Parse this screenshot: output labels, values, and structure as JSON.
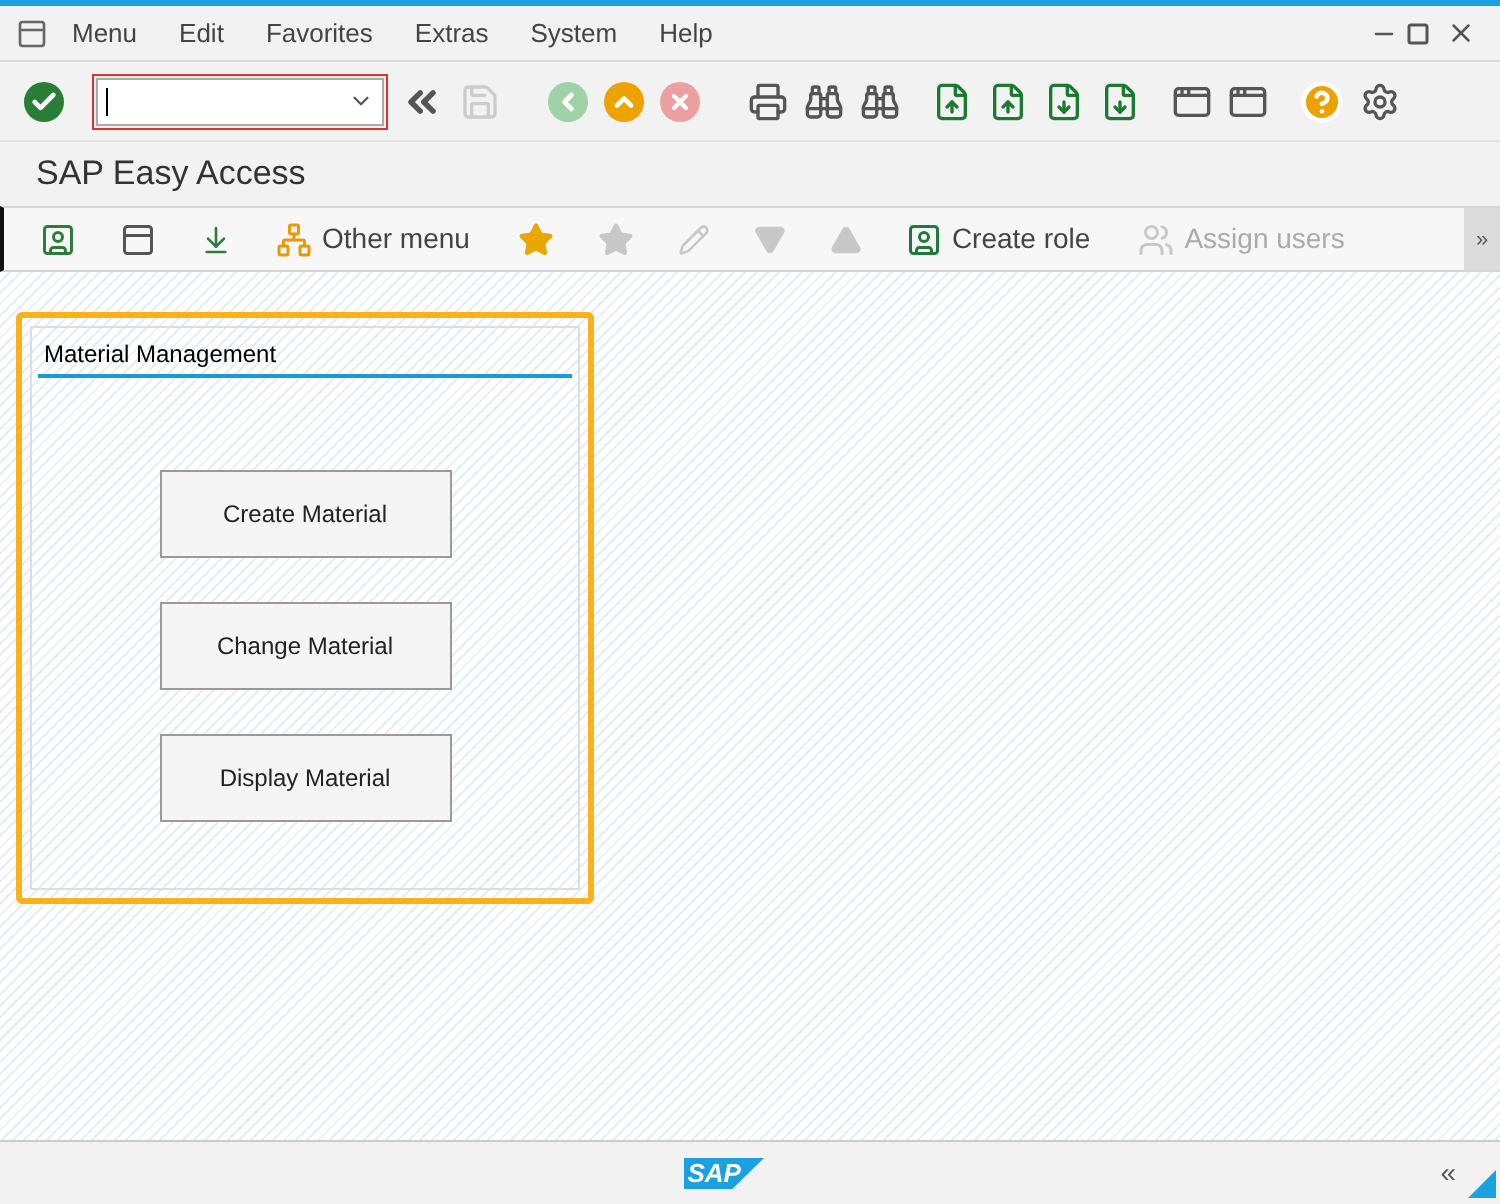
{
  "menu": [
    "Menu",
    "Edit",
    "Favorites",
    "Extras",
    "System",
    "Help"
  ],
  "title": "SAP Easy Access",
  "app_toolbar": [
    {
      "kind": "icon",
      "disabled": false
    },
    {
      "kind": "icon",
      "disabled": false
    },
    {
      "kind": "icon",
      "disabled": false
    },
    {
      "kind": "labeled",
      "label": "Other menu",
      "disabled": false
    },
    {
      "kind": "icon",
      "disabled": false
    },
    {
      "kind": "icon",
      "disabled": true
    },
    {
      "kind": "icon",
      "disabled": true
    },
    {
      "kind": "icon",
      "disabled": true
    },
    {
      "kind": "icon",
      "disabled": true
    },
    {
      "kind": "labeled",
      "label": "Create role",
      "disabled": false
    },
    {
      "kind": "labeled",
      "label": "Assign users",
      "disabled": true
    }
  ],
  "app_toolbar_more": "»",
  "group": {
    "title": "Material Management",
    "highlighted": true,
    "buttons": [
      "Create Material",
      "Change Material",
      "Display Material"
    ]
  },
  "status_bar": {
    "logo": "SAP",
    "expand": "«"
  }
}
